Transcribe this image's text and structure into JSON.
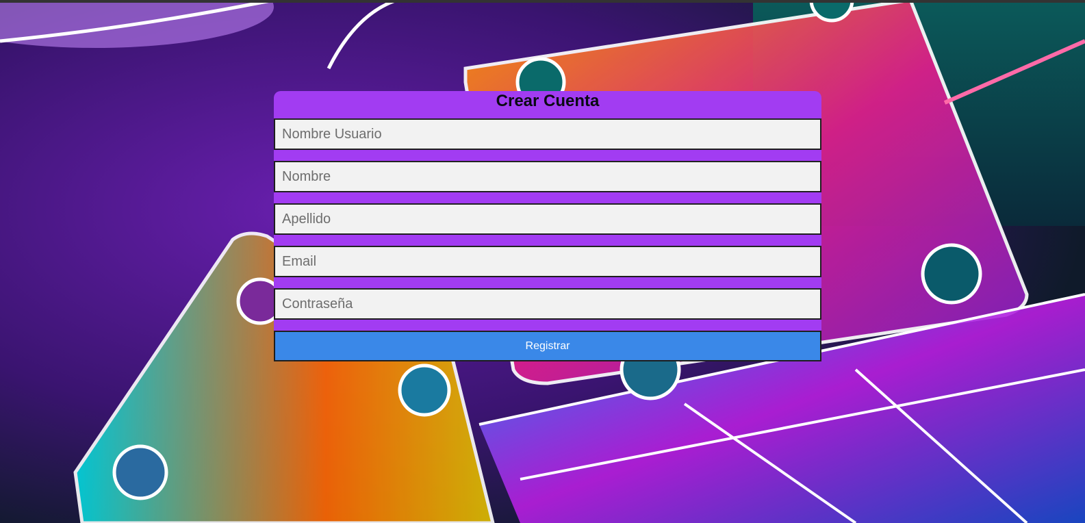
{
  "form": {
    "title": "Crear Cuenta",
    "fields": [
      {
        "name": "username-input",
        "placeholder": "Nombre Usuario",
        "value": ""
      },
      {
        "name": "first-name-input",
        "placeholder": "Nombre",
        "value": ""
      },
      {
        "name": "last-name-input",
        "placeholder": "Apellido",
        "value": ""
      },
      {
        "name": "email-input",
        "placeholder": "Email",
        "value": ""
      },
      {
        "name": "password-input",
        "placeholder": "Contraseña",
        "value": ""
      }
    ],
    "submit_label": "Registrar"
  },
  "colors": {
    "form_background": "#a23cf2",
    "field_background": "#f2f2f2",
    "button_background": "#3a88e8",
    "button_text": "#ffffff"
  }
}
